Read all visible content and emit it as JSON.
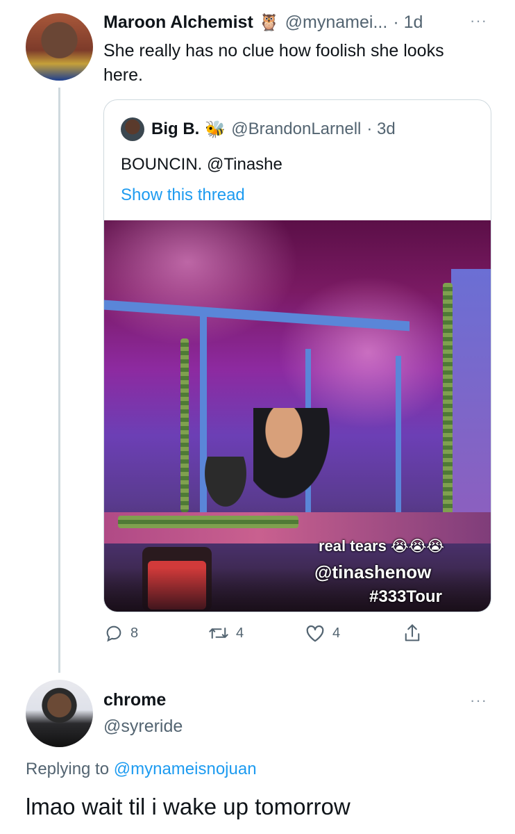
{
  "tweet1": {
    "name": "Maroon Alchemist",
    "name_emoji": "🦉",
    "handle": "@mynamei...",
    "time": "· 1d",
    "more": "···",
    "text": "She really has no clue how foolish she looks here."
  },
  "quote": {
    "name": "Big B.",
    "name_emoji": "🐝",
    "handle": "@BrandonLarnell",
    "time": "· 3d",
    "text": "BOUNCIN. @Tinashe",
    "show_thread": "Show this thread",
    "media_caption": {
      "line1": "real tears 😭😭😭",
      "line2": "@tinashenow",
      "line3": "#333Tour"
    }
  },
  "actions": {
    "replies": "8",
    "retweets": "4",
    "likes": "4"
  },
  "tweet2": {
    "name": "chrome",
    "handle": "@syreride",
    "more": "···",
    "replying_prefix": "Replying to",
    "replying_to": "@mynameisnojuan",
    "text": "lmao wait til i wake up tomorrow"
  },
  "colors": {
    "text": "#0f1419",
    "secondary": "#536471",
    "link": "#1d9bf0",
    "border": "#cfd9de"
  },
  "icons": [
    "owl-emoji",
    "bee-emoji",
    "reply-icon",
    "retweet-icon",
    "like-icon",
    "share-icon",
    "more-icon"
  ]
}
